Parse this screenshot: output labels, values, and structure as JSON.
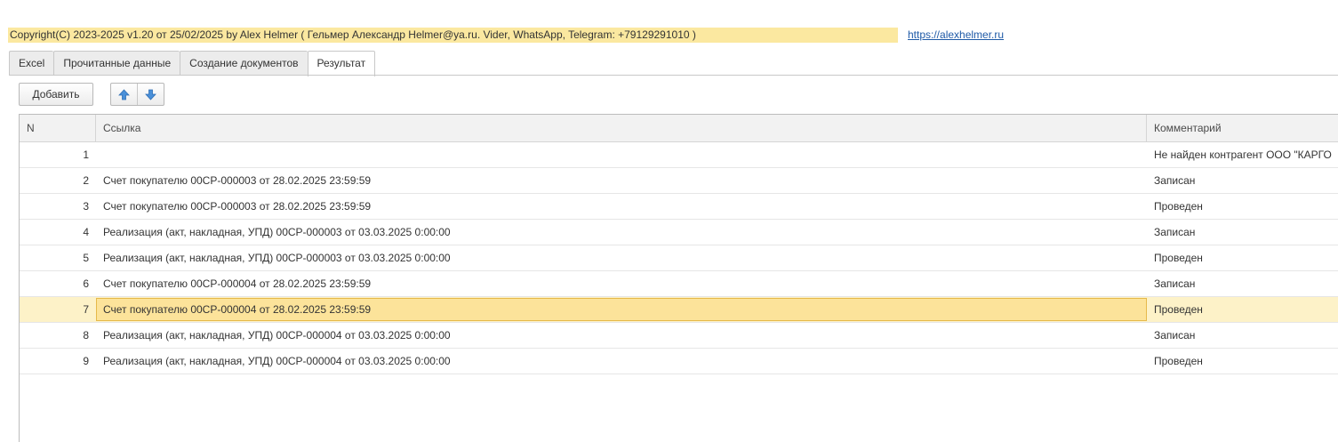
{
  "header": {
    "copyright": "Copyright(C)  2023-2025 v1.20 от 25/02/2025  by Alex Helmer ( Гельмер Александр Helmer@ya.ru. Vider, WhatsApp, Telegram: +79129291010 )",
    "site_link": "https://alexhelmer.ru"
  },
  "tabs": [
    {
      "label": "Excel"
    },
    {
      "label": "Прочитанные данные"
    },
    {
      "label": "Создание документов"
    },
    {
      "label": "Результат"
    }
  ],
  "active_tab": "Результат",
  "toolbar": {
    "add_label": "Добавить",
    "move_up_icon": "arrow-up-icon",
    "move_down_icon": "arrow-down-icon",
    "icon_color": "#4a90d9"
  },
  "table": {
    "columns": {
      "n": "N",
      "link": "Ссылка",
      "comment": "Комментарий"
    },
    "rows": [
      {
        "n": "1",
        "link": "",
        "comment": "Не найден контрагент ООО \"КАРГО"
      },
      {
        "n": "2",
        "link": "Счет покупателю 00СР-000003 от 28.02.2025 23:59:59",
        "comment": "Записан"
      },
      {
        "n": "3",
        "link": "Счет покупателю 00СР-000003 от 28.02.2025 23:59:59",
        "comment": "Проведен"
      },
      {
        "n": "4",
        "link": "Реализация (акт, накладная, УПД) 00СР-000003 от 03.03.2025 0:00:00",
        "comment": "Записан"
      },
      {
        "n": "5",
        "link": "Реализация (акт, накладная, УПД) 00СР-000003 от 03.03.2025 0:00:00",
        "comment": "Проведен"
      },
      {
        "n": "6",
        "link": "Счет покупателю 00СР-000004 от 28.02.2025 23:59:59",
        "comment": "Записан"
      },
      {
        "n": "7",
        "link": "Счет покупателю 00СР-000004 от 28.02.2025 23:59:59",
        "comment": "Проведен"
      },
      {
        "n": "8",
        "link": "Реализация (акт, накладная, УПД) 00СР-000004 от 03.03.2025 0:00:00",
        "comment": "Записан"
      },
      {
        "n": "9",
        "link": "Реализация (акт, накладная, УПД) 00СР-000004 от 03.03.2025 0:00:00",
        "comment": "Проведен"
      }
    ],
    "selected_row": "7"
  },
  "colors": {
    "banner": "#fbe8a0",
    "selected_row": "#fdf2c8",
    "selected_cell": "#fce39a",
    "link": "#1f5aa7"
  }
}
